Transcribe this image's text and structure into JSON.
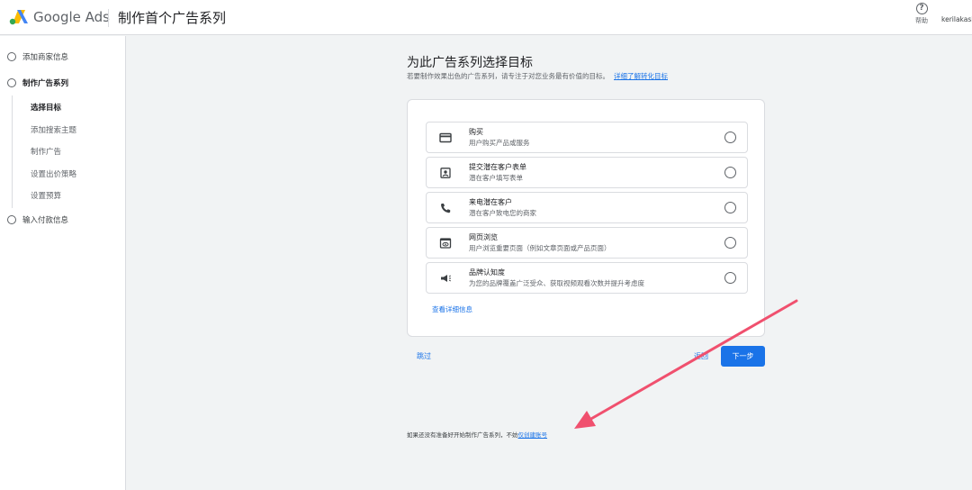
{
  "header": {
    "brand": "Google Ads",
    "title": "制作首个广告系列",
    "help_label": "帮助",
    "account": "kerilakasb"
  },
  "sidebar": {
    "steps": [
      {
        "label": "添加商家信息"
      },
      {
        "label": "制作广告系列"
      },
      {
        "label": "输入付款信息"
      }
    ],
    "substeps": [
      {
        "label": "选择目标"
      },
      {
        "label": "添加搜索主题"
      },
      {
        "label": "制作广告"
      },
      {
        "label": "设置出价策略"
      },
      {
        "label": "设置预算"
      }
    ]
  },
  "main": {
    "title": "为此广告系列选择目标",
    "description": "若要制作效果出色的广告系列，请专注于对您业务最有价值的目标。",
    "learn_more": "详细了解转化目标",
    "options": [
      {
        "icon": "credit-card-icon",
        "title": "购买",
        "desc": "用户购买产品或服务"
      },
      {
        "icon": "contact-form-icon",
        "title": "提交潜在客户表单",
        "desc": "潜在客户填写表单"
      },
      {
        "icon": "phone-icon",
        "title": "来电潜在客户",
        "desc": "潜在客户致电您的商家"
      },
      {
        "icon": "web-page-icon",
        "title": "网页浏览",
        "desc": "用户浏览重要页面（例如文章页面或产品页面）"
      },
      {
        "icon": "megaphone-icon",
        "title": "品牌认知度",
        "desc": "为您的品牌覆盖广泛受众、获取视频观看次数并提升考虑度"
      }
    ],
    "details_link": "查看详细信息",
    "skip": "跳过",
    "back": "返回",
    "next": "下一步"
  },
  "footer": {
    "note": "如果还没有准备好开始制作广告系列，不妨",
    "link": "仅创建账号"
  },
  "colors": {
    "accent": "#1a73e8",
    "annotation_arrow": "#f0506e"
  }
}
